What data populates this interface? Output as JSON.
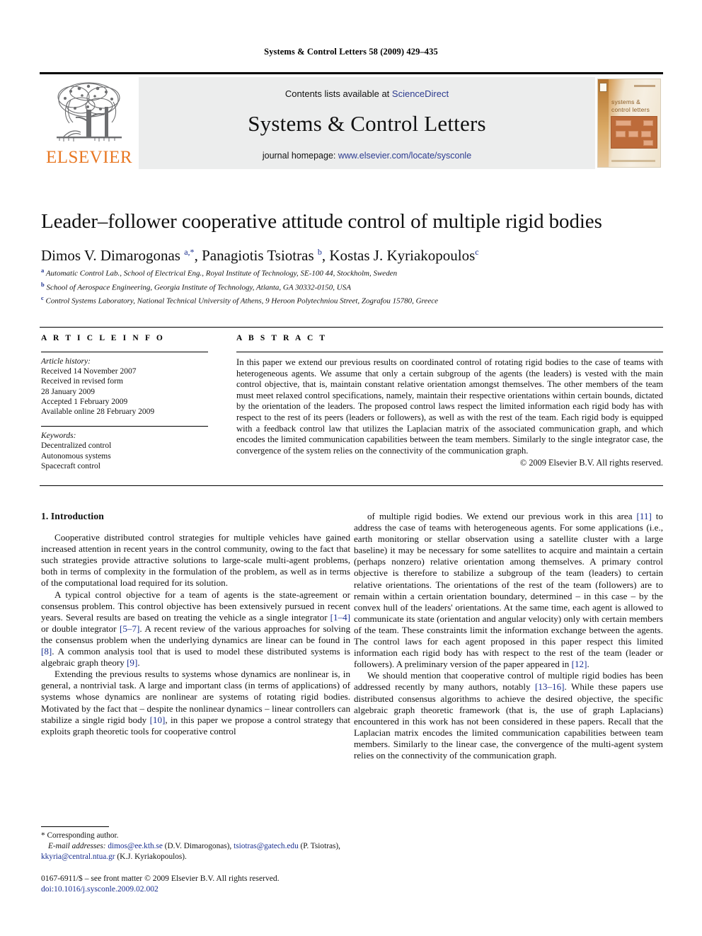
{
  "running_head": "Systems & Control Letters 58 (2009) 429–435",
  "masthead": {
    "publisher_wordmark": "ELSEVIER",
    "contents_prefix": "Contents lists available at ",
    "contents_link": "ScienceDirect",
    "journal_title": "Systems & Control Letters",
    "homepage_prefix": "journal homepage: ",
    "homepage_link": "www.elsevier.com/locate/sysconle",
    "cover_title": "systems & control letters",
    "accent_color": "#E87722",
    "link_color": "#2b3a8f",
    "banner_bg": "#eceded"
  },
  "article": {
    "title": "Leader–follower cooperative attitude control of multiple rigid bodies",
    "authors_html": "Dimos V. Dimarogonas <sup class=\"blue\">a,*</sup>, Panagiotis Tsiotras <sup class=\"blue\">b</sup>, Kostas J. Kyriakopoulos<sup class=\"blue\">c</sup>",
    "affiliations": [
      {
        "mark": "a",
        "text": "Automatic Control Lab., School of Electrical Eng., Royal Institute of Technology, SE-100 44, Stockholm, Sweden"
      },
      {
        "mark": "b",
        "text": "School of Aerospace Engineering, Georgia Institute of Technology, Atlanta, GA 30332-0150, USA"
      },
      {
        "mark": "c",
        "text": "Control Systems Laboratory, National Technical University of Athens, 9 Heroon Polytechniou Street, Zografou 15780, Greece"
      }
    ]
  },
  "article_info": {
    "heading": "A R T I C L E   I N F O",
    "history_label": "Article history:",
    "history": [
      "Received 14 November 2007",
      "Received in revised form",
      "28 January 2009",
      "Accepted 1 February 2009",
      "Available online 28 February 2009"
    ],
    "keywords_label": "Keywords:",
    "keywords": [
      "Decentralized control",
      "Autonomous systems",
      "Spacecraft control"
    ]
  },
  "abstract": {
    "heading": "A B S T R A C T",
    "text": "In this paper we extend our previous results on coordinated control of rotating rigid bodies to the case of teams with heterogeneous agents. We assume that only a certain subgroup of the agents (the leaders) is vested with the main control objective, that is, maintain constant relative orientation amongst themselves. The other members of the team must meet relaxed control specifications, namely, maintain their respective orientations within certain bounds, dictated by the orientation of the leaders. The proposed control laws respect the limited information each rigid body has with respect to the rest of its peers (leaders or followers), as well as with the rest of the team. Each rigid body is equipped with a feedback control law that utilizes the Laplacian matrix of the associated communication graph, and which encodes the limited communication capabilities between the team members. Similarly to the single integrator case, the convergence of the system relies on the connectivity of the communication graph.",
    "copyright": "© 2009 Elsevier B.V. All rights reserved."
  },
  "body": {
    "section_heading": "1. Introduction",
    "left_paragraphs": [
      "Cooperative distributed control strategies for multiple vehicles have gained increased attention in recent years in the control community, owing to the fact that such strategies provide attractive solutions to large-scale multi-agent problems, both in terms of complexity in the formulation of the problem, as well as in terms of the computational load required for its solution.",
      "A typical control objective for a team of agents is the state-agreement or consensus problem. This control objective has been extensively pursued in recent years. Several results are based on treating the vehicle as a single integrator <span class=\"ref\">[1–4]</span> or double integrator <span class=\"ref\">[5–7]</span>. A recent review of the various approaches for solving the consensus problem when the underlying dynamics are linear can be found in <span class=\"ref\">[8]</span>. A common analysis tool that is used to model these distributed systems is algebraic graph theory <span class=\"ref\">[9]</span>.",
      "Extending the previous results to systems whose dynamics are nonlinear is, in general, a nontrivial task. A large and important class (in terms of applications) of systems whose dynamics are nonlinear are systems of rotating rigid bodies. Motivated by the fact that – despite the nonlinear dynamics – linear controllers can stabilize a single rigid body <span class=\"ref\">[10]</span>, in this paper we propose a control strategy that exploits graph theoretic tools for cooperative control"
    ],
    "right_paragraphs": [
      "of multiple rigid bodies. We extend our previous work in this area <span class=\"ref\">[11]</span> to address the case of teams with heterogeneous agents. For some applications (i.e., earth monitoring or stellar observation using a satellite cluster with a large baseline) it may be necessary for some satellites to acquire and maintain a certain (perhaps nonzero) relative orientation among themselves. A primary control objective is therefore to stabilize a subgroup of the team (leaders) to certain relative orientations. The orientations of the rest of the team (followers) are to remain within a certain orientation boundary, determined – in this case – by the convex hull of the leaders' orientations. At the same time, each agent is allowed to communicate its state (orientation and angular velocity) only with certain members of the team. These constraints limit the information exchange between the agents. The control laws for each agent proposed in this paper respect this limited information each rigid body has with respect to the rest of the team (leader or followers). A preliminary version of the paper appeared in <span class=\"ref\">[12]</span>.",
      "We should mention that cooperative control of multiple rigid bodies has been addressed recently by many authors, notably <span class=\"ref\">[13–16]</span>. While these papers use distributed consensus algorithms to achieve the desired objective, the specific algebraic graph theoretic framework (that is, the use of graph Laplacians) encountered in this work has not been considered in these papers. Recall that the Laplacian matrix encodes the limited communication capabilities between team members. Similarly to the linear case, the convergence of the multi-agent system relies on the connectivity of the communication graph."
    ]
  },
  "footnotes": {
    "corresponding": "* Corresponding author.",
    "emails_html": "<span class=\"lbl\">E-mail addresses:</span> <span class=\"mail\">dimos@ee.kth.se</span> (D.V. Dimarogonas), <span class=\"mail\">tsiotras@gatech.edu</span> (P. Tsiotras), <span class=\"mail\">kkyria@central.ntua.gr</span> (K.J. Kyriakopoulos).",
    "issn_line": "0167-6911/$ – see front matter © 2009 Elsevier B.V. All rights reserved.",
    "doi": "doi:10.1016/j.sysconle.2009.02.002"
  }
}
